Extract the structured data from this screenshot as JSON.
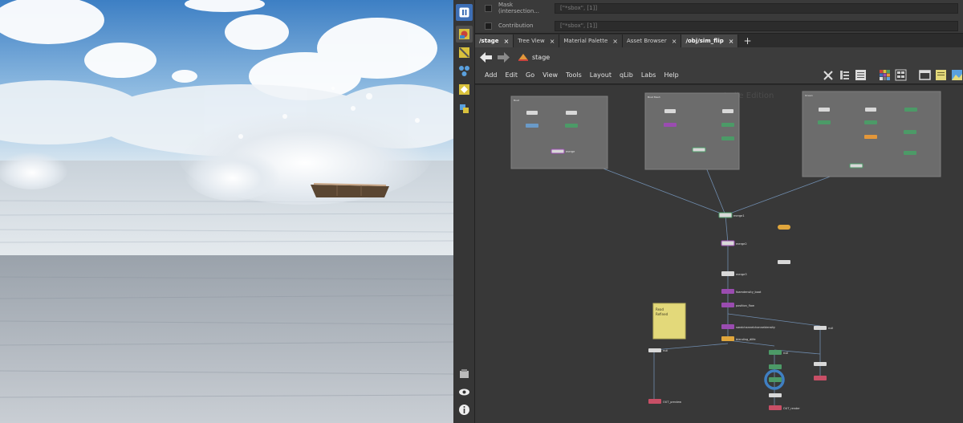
{
  "parameters": {
    "rows": [
      {
        "label": "Mask (intersection...",
        "value": "[\"*sbox\", [1]]"
      },
      {
        "label": "Contribution",
        "value": "[\"*sbox\", [1]]"
      }
    ]
  },
  "tabs": [
    {
      "label": "/stage",
      "active": true
    },
    {
      "label": "Tree View",
      "active": false
    },
    {
      "label": "Material Palette",
      "active": false
    },
    {
      "label": "Asset Browser",
      "active": false
    },
    {
      "label": "/obj/sim_flip",
      "active": true
    }
  ],
  "tab_close_glyph": "×",
  "tab_add_glyph": "+",
  "path": {
    "current": "stage",
    "icon": "stage-icon"
  },
  "menu": [
    "Add",
    "Edit",
    "Go",
    "View",
    "Tools",
    "Layout",
    "qLib",
    "Labs",
    "Help"
  ],
  "network": {
    "context_watermark": "Indie Edition",
    "boxes": [
      {
        "title": "Boat"
      },
      {
        "title": "Boat Mesh"
      },
      {
        "title": "Ocean"
      }
    ],
    "sticky_note": {
      "line1": "Read",
      "line2": "Refined"
    },
    "nodes": {
      "merge_boat": "merge",
      "merge_main": "merge1",
      "merge2": "merge2",
      "merge3": "merge3",
      "foam_density": "foamdensity_boat",
      "position_flow": "position_flow",
      "sand_channel": "sandchannelchanneldensity",
      "blending_dilfe": "blending_dilfe",
      "null_center": "null",
      "null_left": "null",
      "null_right": "null",
      "out_left": "OUT_preview",
      "out_right": "OUT_render"
    }
  },
  "colors": {
    "network_bg": "#383838",
    "netbox": "#6c6c6c",
    "sticky": "#e3d97a",
    "wire": "#6f8cae",
    "node_green": "#4c9a67",
    "node_purple": "#9a4cb0",
    "node_orange": "#e0a63c",
    "node_red": "#c84f66",
    "selected_ring": "#3f7fc2"
  }
}
